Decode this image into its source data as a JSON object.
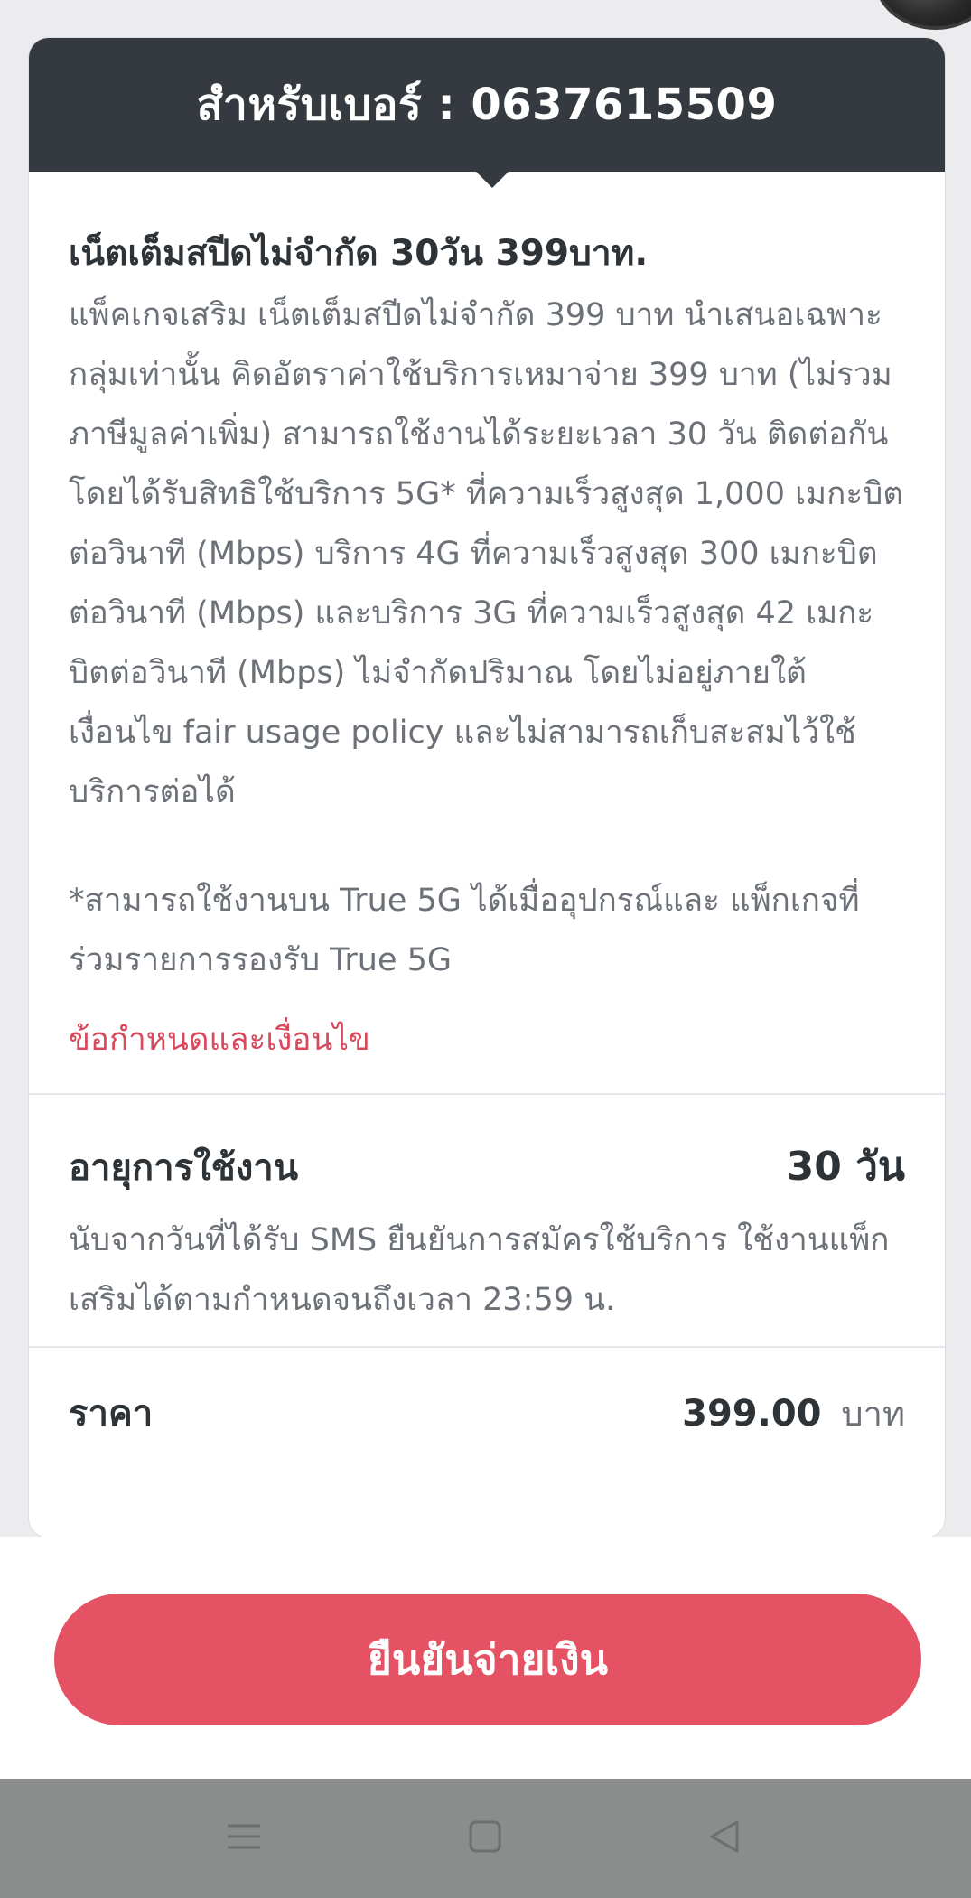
{
  "header": {
    "title": "สำหรับเบอร์ : 0637615509"
  },
  "package": {
    "title": "เน็ตเต็มสปีดไม่จำกัด 30วัน 399บาท.",
    "description": "แพ็คเกจเสริม เน็ตเต็มสปีดไม่จำกัด 399 บาท นำเสนอเฉพาะกลุ่มเท่านั้น คิดอัตราค่าใช้บริการเหมาจ่าย 399 บาท (ไม่รวมภาษีมูลค่าเพิ่ม) สามารถใช้งานได้ระยะเวลา 30 วัน ติดต่อกัน โดยได้รับสิทธิใช้บริการ 5G* ที่ความเร็วสูงสุด 1,000 เมกะบิตต่อวินาที (Mbps) บริการ 4G ที่ความเร็วสูงสุด 300 เมกะบิตต่อวินาที (Mbps) และบริการ 3G ที่ความเร็วสูงสุด 42 เมกะบิตต่อวินาที (Mbps) ไม่จำกัดปริมาณ โดยไม่อยู่ภายใต้เงื่อนไข fair usage policy และไม่สามารถเก็บสะสมไว้ใช้บริการต่อได้",
    "note": "*สามารถใช้งานบน True 5G ได้เมื่ออุปกรณ์และ แพ็กเกจที่ร่วมรายการรองรับ True 5G",
    "terms_link": "ข้อกำหนดและเงื่อนไข"
  },
  "duration": {
    "label": "อายุการใช้งาน",
    "value": "30 วัน",
    "description": "นับจากวันที่ได้รับ SMS ยืนยันการสมัครใช้บริการ ใช้งานแพ็กเสริมได้ตามกำหนดจนถึงเวลา 23:59 น."
  },
  "price": {
    "label": "ราคา",
    "value": "399.00",
    "unit": "บาท"
  },
  "actions": {
    "confirm_label": "ยืนยันจ่ายเงิน"
  },
  "nav": {
    "icons": [
      "menu-icon",
      "home-icon",
      "back-icon"
    ]
  },
  "colors": {
    "header_bg": "#343a40",
    "accent": "#e45264",
    "link": "#d9495d",
    "nav_bg": "#8a8d8c"
  }
}
